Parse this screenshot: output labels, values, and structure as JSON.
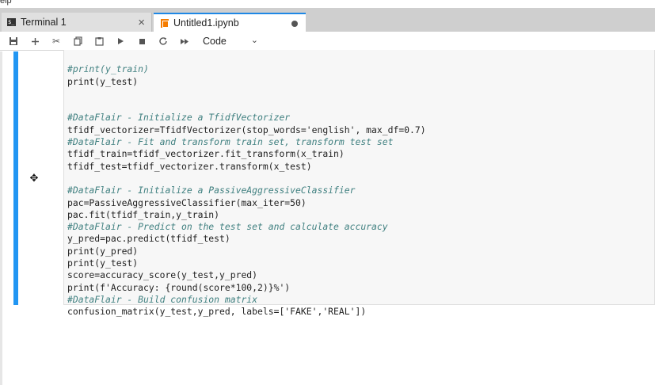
{
  "top": {
    "label": "elp"
  },
  "tabs": [
    {
      "label": "Terminal 1",
      "icon": "terminal-icon",
      "action": "close"
    },
    {
      "label": "Untitled1.ipynb",
      "icon": "notebook-icon",
      "action": "unsaved-dot"
    }
  ],
  "toolbar": {
    "buttons": [
      "save-icon",
      "add-icon",
      "cut-icon",
      "copy-icon",
      "paste-icon",
      "run-icon",
      "stop-icon",
      "restart-icon",
      "fast-forward-icon"
    ],
    "cell_type": "Code"
  },
  "code_lines": [
    "#print(y_train)",
    "print(y_test)",
    "",
    "",
    "#DataFlair - Initialize a TfidfVectorizer",
    "tfidf_vectorizer=TfidfVectorizer(stop_words='english', max_df=0.7)",
    "#DataFlair - Fit and transform train set, transform test set",
    "tfidf_train=tfidf_vectorizer.fit_transform(x_train)",
    "tfidf_test=tfidf_vectorizer.transform(x_test)",
    "",
    "#DataFlair - Initialize a PassiveAggressiveClassifier",
    "pac=PassiveAggressiveClassifier(max_iter=50)",
    "pac.fit(tfidf_train,y_train)",
    "#DataFlair - Predict on the test set and calculate accuracy",
    "y_pred=pac.predict(tfidf_test)",
    "print(y_pred)",
    "print(y_test)",
    "score=accuracy_score(y_test,y_pred)",
    "print(f'Accuracy: {round(score*100,2)}%')",
    "#DataFlair - Build confusion matrix",
    "confusion_matrix(y_test,y_pred, labels=['FAKE','REAL'])"
  ]
}
